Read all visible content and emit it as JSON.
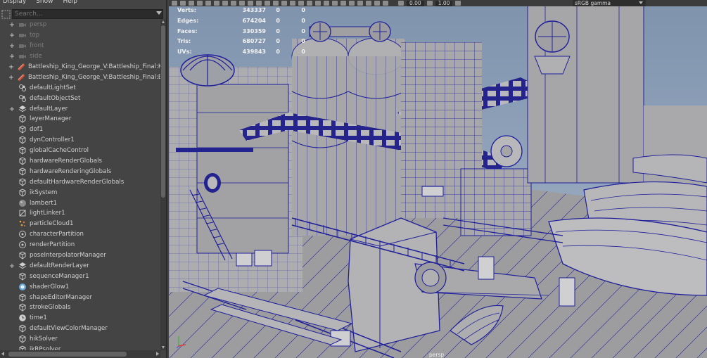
{
  "outliner": {
    "menu": [
      "Display",
      "Show",
      "Help"
    ],
    "search": {
      "placeholder": "Search..."
    },
    "items": [
      {
        "label": "persp",
        "expandable": true,
        "dim": true,
        "icon": "camera-icon"
      },
      {
        "label": "top",
        "expandable": true,
        "dim": true,
        "icon": "camera-icon"
      },
      {
        "label": "front",
        "expandable": true,
        "dim": true,
        "icon": "camera-icon"
      },
      {
        "label": "side",
        "expandable": true,
        "dim": true,
        "icon": "camera-icon"
      },
      {
        "label": "Battleship_King_George_V:Battleship_Final:King_",
        "expandable": true,
        "dim": false,
        "icon": "reference-icon"
      },
      {
        "label": "Battleship_King_George_V:Battleship_Final:Base",
        "expandable": true,
        "dim": false,
        "icon": "reference-icon"
      },
      {
        "label": "defaultLightSet",
        "expandable": false,
        "dim": false,
        "icon": "set-icon"
      },
      {
        "label": "defaultObjectSet",
        "expandable": false,
        "dim": false,
        "icon": "set-icon"
      },
      {
        "label": "defaultLayer",
        "expandable": true,
        "dim": false,
        "icon": "layer-icon"
      },
      {
        "label": "layerManager",
        "expandable": false,
        "dim": false,
        "icon": "node-icon"
      },
      {
        "label": "dof1",
        "expandable": false,
        "dim": false,
        "icon": "node-icon"
      },
      {
        "label": "dynController1",
        "expandable": false,
        "dim": false,
        "icon": "node-icon"
      },
      {
        "label": "globalCacheControl",
        "expandable": false,
        "dim": false,
        "icon": "node-icon"
      },
      {
        "label": "hardwareRenderGlobals",
        "expandable": false,
        "dim": false,
        "icon": "node-icon"
      },
      {
        "label": "hardwareRenderingGlobals",
        "expandable": false,
        "dim": false,
        "icon": "node-icon"
      },
      {
        "label": "defaultHardwareRenderGlobals",
        "expandable": false,
        "dim": false,
        "icon": "node-icon"
      },
      {
        "label": "ikSystem",
        "expandable": false,
        "dim": false,
        "icon": "node-icon"
      },
      {
        "label": "lambert1",
        "expandable": false,
        "dim": false,
        "icon": "shader-sphere-icon"
      },
      {
        "label": "lightLinker1",
        "expandable": false,
        "dim": false,
        "icon": "light-linker-icon"
      },
      {
        "label": "particleCloud1",
        "expandable": false,
        "dim": false,
        "icon": "particle-icon"
      },
      {
        "label": "characterPartition",
        "expandable": false,
        "dim": false,
        "icon": "partition-icon"
      },
      {
        "label": "renderPartition",
        "expandable": false,
        "dim": false,
        "icon": "partition-icon"
      },
      {
        "label": "poseInterpolatorManager",
        "expandable": false,
        "dim": false,
        "icon": "node-icon"
      },
      {
        "label": "defaultRenderLayer",
        "expandable": true,
        "dim": false,
        "icon": "layer-icon"
      },
      {
        "label": "sequenceManager1",
        "expandable": false,
        "dim": false,
        "icon": "node-icon"
      },
      {
        "label": "shaderGlow1",
        "expandable": false,
        "dim": false,
        "icon": "glow-icon"
      },
      {
        "label": "shapeEditorManager",
        "expandable": false,
        "dim": false,
        "icon": "node-icon"
      },
      {
        "label": "strokeGlobals",
        "expandable": false,
        "dim": false,
        "icon": "node-icon"
      },
      {
        "label": "time1",
        "expandable": false,
        "dim": false,
        "icon": "clock-icon"
      },
      {
        "label": "defaultViewColorManager",
        "expandable": false,
        "dim": false,
        "icon": "node-icon"
      },
      {
        "label": "hikSolver",
        "expandable": false,
        "dim": false,
        "icon": "node-icon"
      },
      {
        "label": "ikRPsolver",
        "expandable": false,
        "dim": false,
        "icon": "node-icon"
      }
    ]
  },
  "viewport": {
    "toolbar": {
      "field_a": "0.00",
      "field_b": "1.00",
      "color_space": "sRGB gamma"
    },
    "hud": [
      {
        "label": "Verts:",
        "v1": "343337",
        "v2": "0",
        "v3": "0"
      },
      {
        "label": "Edges:",
        "v1": "674204",
        "v2": "0",
        "v3": "0"
      },
      {
        "label": "Faces:",
        "v1": "330359",
        "v2": "0",
        "v3": "0"
      },
      {
        "label": "Tris:",
        "v1": "680727",
        "v2": "0",
        "v3": "0"
      },
      {
        "label": "UVs:",
        "v1": "439843",
        "v2": "0",
        "v3": "0"
      }
    ],
    "camera": "persp",
    "colors": {
      "wire": "#1a1a9c",
      "surface": "#a9a9ab",
      "sky": "#8aa0b8"
    }
  }
}
